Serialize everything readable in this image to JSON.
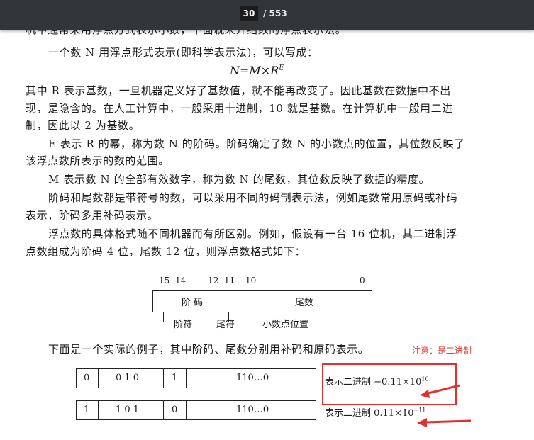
{
  "toolbar": {
    "current_page": "30",
    "total_pages": "/ 553"
  },
  "text": {
    "line0": "机中通常采用浮点方式表示小数，下面就来介绍数的浮点表示法。",
    "line1": "一个数 N 用浮点形式表示(即科学表示法)，可以写成：",
    "formula_base": "N=M×R",
    "formula_exp": "E",
    "line2": "其中 R 表示基数，一旦机器定义好了基数值，就不能再改变了。因此基数在数据中不出",
    "line3": "现，是隐含的。在人工计算中，一般采用十进制，10 就是基数。在计算机中一般用二进",
    "line4": "制，因此以 2 为基数。",
    "line5": "E 表示 R 的幂，称为数 N 的阶码。阶码确定了数 N 的小数点的位置，其位数反映了",
    "line6": "该浮点数所表示的数的范围。",
    "line7": "M 表示数 N 的全部有效数字，称为数 N 的尾数，其位数反映了数据的精度。",
    "line8": "阶码和尾数都是带符号的数，可以采用不同的码制表示法，例如尾数常用原码或补码",
    "line9": "表示，阶码多用补码表示。",
    "line10": "浮点数的具体格式随不同机器而有所区别。例如，假设有一台 16 位机，其二进制浮",
    "line11": "点数组成为阶码 4 位，尾数 12 位，则浮点数格式如下：",
    "line12": "下面是一个实际的例子，其中阶码、尾数分别用补码和原码表示。"
  },
  "format_diagram": {
    "bit_labels": [
      "15",
      "14",
      "12",
      "11",
      "10",
      "0"
    ],
    "field_exponent": "阶 码",
    "field_mantissa": "尾数",
    "label_exp_sign": "阶符",
    "label_man_sign": "尾符",
    "label_point": "小数点位置"
  },
  "examples": [
    {
      "exp_sign": "0",
      "exp": "0 1 0",
      "man_sign": "1",
      "man": "110…0",
      "desc": "表示二进制 −0.11×10",
      "sup": "10"
    },
    {
      "exp_sign": "1",
      "exp": "1 0 1",
      "man_sign": "0",
      "man": "110…0",
      "desc": "表示二进制 0.11×10",
      "sup": "−11"
    }
  ],
  "annotation": {
    "note": "注意：是二进制",
    "color": "#e2302c"
  }
}
